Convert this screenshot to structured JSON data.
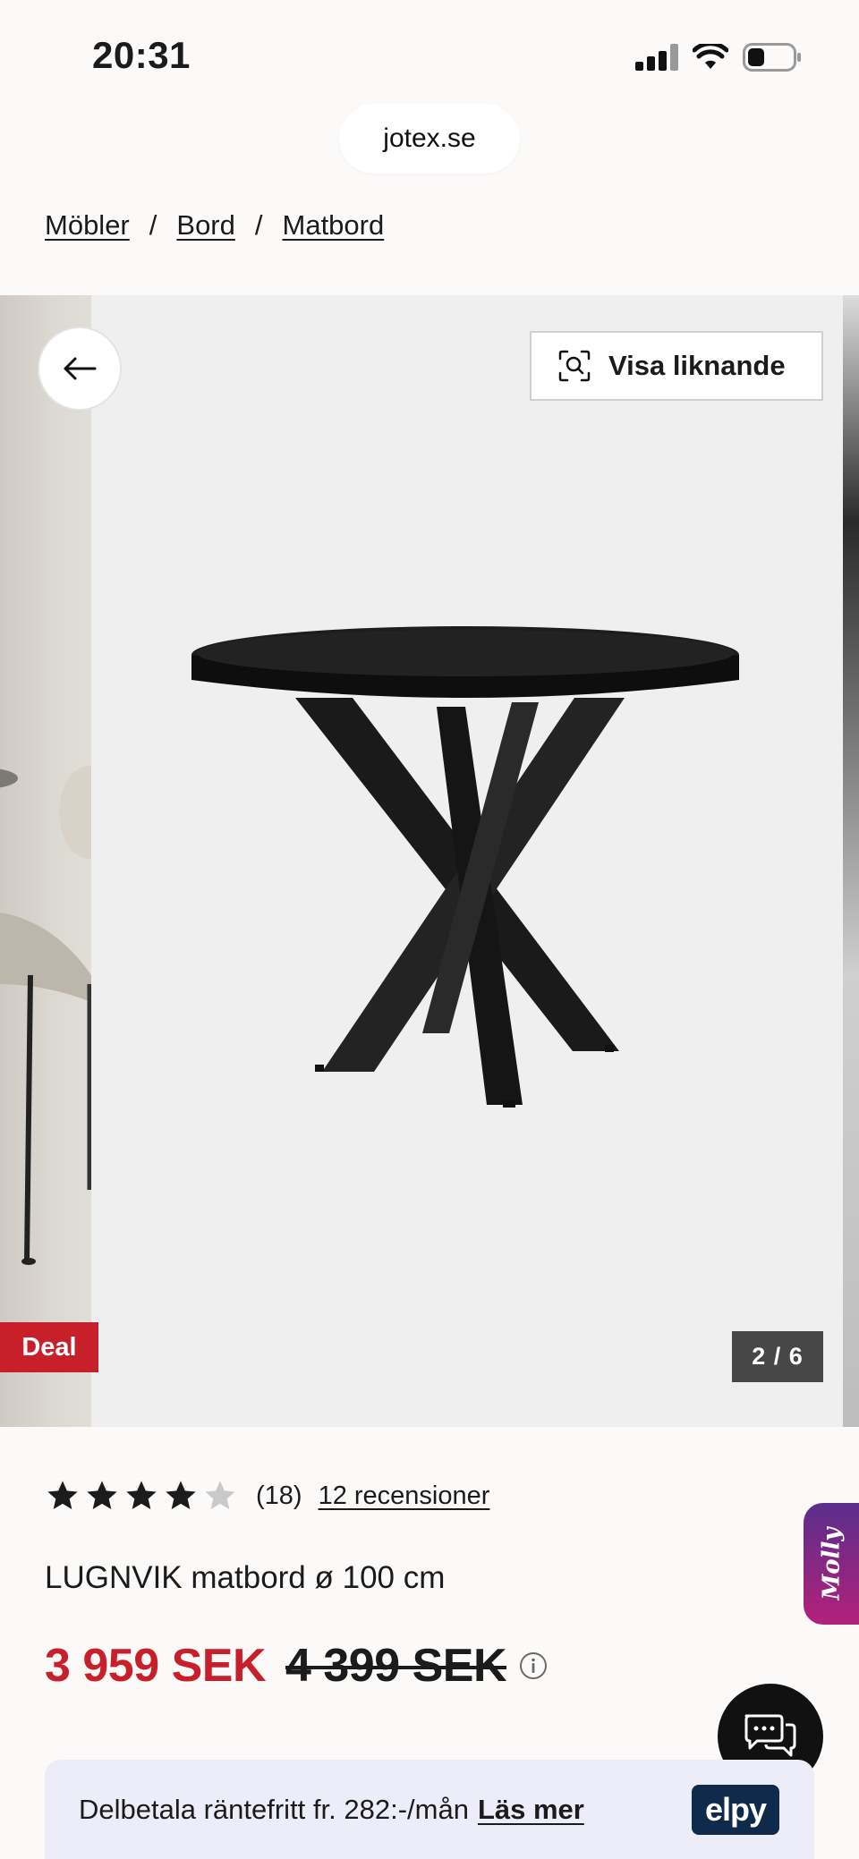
{
  "status_bar": {
    "time": "20:31"
  },
  "browser": {
    "url": "jotex.se"
  },
  "breadcrumb": {
    "items": [
      "Möbler",
      "Bord",
      "Matbord"
    ],
    "separator": "/"
  },
  "gallery": {
    "similar_label": "Visa liknande",
    "badge": "Deal",
    "counter": "2 / 6"
  },
  "product": {
    "rating_value": 4,
    "rating_max": 5,
    "rating_count": "(18)",
    "reviews_link": "12 recensioner",
    "title": "LUGNVIK matbord ø 100 cm",
    "price_current": "3 959 SEK",
    "price_original": "4 399 SEK"
  },
  "side_tab": {
    "label": "Molly"
  },
  "financing": {
    "text": "Delbetala räntefritt fr. 282:-/mån",
    "link": "Läs mer",
    "logo": "elpy"
  },
  "colors": {
    "sale_red": "#c8202b",
    "badge_grey": "#474747",
    "banner_bg": "#ecedf8",
    "elpy_navy": "#0f2a4a"
  },
  "icons": {
    "back": "arrow-left-icon",
    "similar": "visual-search-icon",
    "info": "info-icon",
    "chat": "chat-bubbles-icon",
    "star": "star-icon"
  }
}
